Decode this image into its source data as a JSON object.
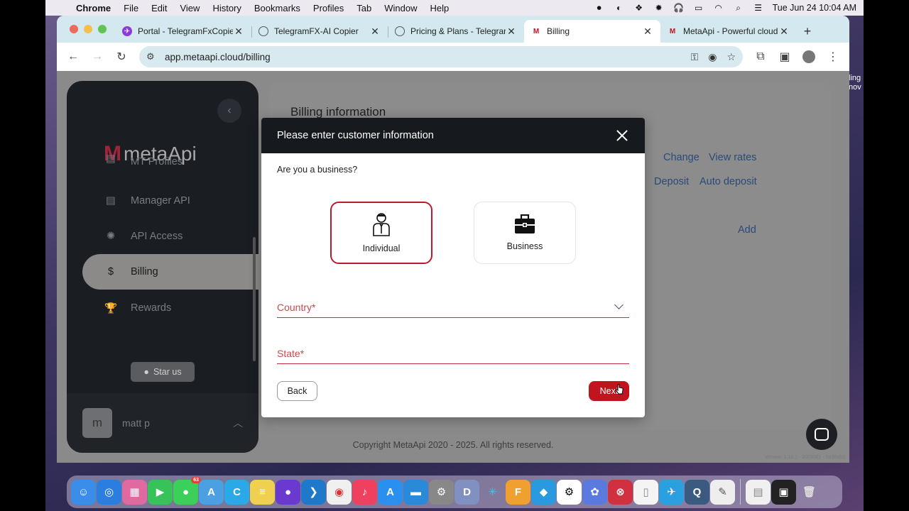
{
  "menubar": {
    "app": "Chrome",
    "items": [
      "File",
      "Edit",
      "View",
      "History",
      "Bookmarks",
      "Profiles",
      "Tab",
      "Window",
      "Help"
    ],
    "datetime": "Tue Jun 24  10:04 AM"
  },
  "tabs": [
    {
      "title": "Portal - TelegramFxCopier",
      "favicon": "telegramfx-icon",
      "color": "#8b3ad6"
    },
    {
      "title": "TelegramFX-AI Copier",
      "favicon": "globe-icon",
      "color": "#555555"
    },
    {
      "title": "Pricing & Plans - TelegramFx",
      "favicon": "globe-icon",
      "color": "#555555"
    },
    {
      "title": "Billing",
      "favicon": "metaapi-icon",
      "color": "#c0141f",
      "active": true
    },
    {
      "title": "MetaApi - Powerful cloud",
      "favicon": "metaapi-icon",
      "color": "#c0141f"
    }
  ],
  "address_bar": {
    "url": "app.metaapi.cloud/billing"
  },
  "sidebar": {
    "logo": "metaApi",
    "items": [
      {
        "label": "MT Profiles",
        "icon": "server-icon"
      },
      {
        "label": "Manager API",
        "icon": "server-icon"
      },
      {
        "label": "API Access",
        "icon": "api-icon"
      },
      {
        "label": "Billing",
        "icon": "money-bag-icon",
        "active": true
      },
      {
        "label": "Rewards",
        "icon": "trophy-icon"
      }
    ],
    "star_button": "Star us",
    "user": {
      "initial": "m",
      "name": "matt p"
    }
  },
  "background_page": {
    "title": "Billing information",
    "links": [
      "Change",
      "View rates",
      "Deposit",
      "Auto deposit",
      "Add"
    ],
    "copyright": "Copyright MetaApi 2020 - 2025. All rights reserved.",
    "version": "Version: 1.16.1 - 2025061 - 5a36ab3"
  },
  "modal": {
    "title": "Please enter customer information",
    "question": "Are you a business?",
    "options": [
      {
        "label": "Individual",
        "icon": "person-icon",
        "selected": true
      },
      {
        "label": "Business",
        "icon": "briefcase-icon",
        "selected": false
      }
    ],
    "country_label": "Country",
    "state_label": "State",
    "required_mark": "*",
    "back_label": "Back",
    "next_label": "Next"
  },
  "wallpaper_text": [
    "ling",
    "nov"
  ],
  "dock": {
    "messages_badge": "63"
  },
  "colors": {
    "accent": "#c0141f",
    "sidebar_bg": "#1a1d22",
    "modal_header": "#16191e"
  }
}
